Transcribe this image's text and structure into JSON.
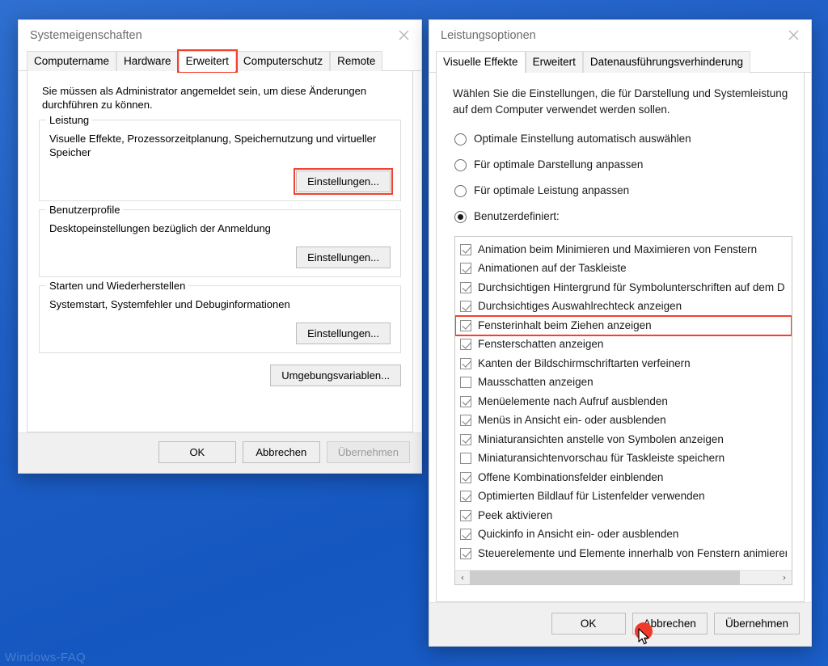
{
  "desktop": {
    "watermark": "Windows-FAQ",
    "background_color": "#1f5fc6"
  },
  "accent": {
    "highlight_color": "#f4402f",
    "click_dot_color": "#ef3a2a"
  },
  "system_properties": {
    "title": "Systemeigenschaften",
    "close_label": "close-icon",
    "tabs": [
      {
        "label": "Computername",
        "active": false
      },
      {
        "label": "Hardware",
        "active": false
      },
      {
        "label": "Erweitert",
        "active": true
      },
      {
        "label": "Computerschutz",
        "active": false
      },
      {
        "label": "Remote",
        "active": false
      }
    ],
    "admin_note": "Sie müssen als Administrator angemeldet sein, um diese Änderungen durchführen zu können.",
    "groups": [
      {
        "legend": "Leistung",
        "text": "Visuelle Effekte, Prozessorzeitplanung, Speichernutzung und virtueller Speicher",
        "button": "Einstellungen...",
        "highlighted": true
      },
      {
        "legend": "Benutzerprofile",
        "text": "Desktopeinstellungen bezüglich der Anmeldung",
        "button": "Einstellungen...",
        "highlighted": false
      },
      {
        "legend": "Starten und Wiederherstellen",
        "text": "Systemstart, Systemfehler und Debuginformationen",
        "button": "Einstellungen...",
        "highlighted": false
      }
    ],
    "env_button": "Umgebungsvariablen...",
    "footer": {
      "ok": "OK",
      "cancel": "Abbrechen",
      "apply": "Übernehmen",
      "apply_disabled": true
    }
  },
  "performance_options": {
    "title": "Leistungsoptionen",
    "close_label": "close-icon",
    "tabs": [
      {
        "label": "Visuelle Effekte",
        "active": true
      },
      {
        "label": "Erweitert",
        "active": false
      },
      {
        "label": "Datenausführungsverhinderung",
        "active": false
      }
    ],
    "intro": "Wählen Sie die Einstellungen, die für Darstellung und Systemleistung auf dem Computer verwendet werden sollen.",
    "radios": [
      {
        "label": "Optimale Einstellung automatisch auswählen",
        "checked": false
      },
      {
        "label": "Für optimale Darstellung anpassen",
        "checked": false
      },
      {
        "label": "Für optimale Leistung anpassen",
        "checked": false
      },
      {
        "label": "Benutzerdefiniert:",
        "checked": true
      }
    ],
    "effects": [
      {
        "label": "Animation beim Minimieren und Maximieren von Fenstern",
        "checked": true,
        "highlighted": false
      },
      {
        "label": "Animationen auf der Taskleiste",
        "checked": true,
        "highlighted": false
      },
      {
        "label": "Durchsichtigen Hintergrund für Symbolunterschriften auf dem D",
        "checked": true,
        "highlighted": false
      },
      {
        "label": "Durchsichtiges Auswahlrechteck anzeigen",
        "checked": true,
        "highlighted": false
      },
      {
        "label": "Fensterinhalt beim Ziehen anzeigen",
        "checked": true,
        "highlighted": true
      },
      {
        "label": "Fensterschatten anzeigen",
        "checked": true,
        "highlighted": false
      },
      {
        "label": "Kanten der Bildschirmschriftarten verfeinern",
        "checked": true,
        "highlighted": false
      },
      {
        "label": "Mausschatten anzeigen",
        "checked": false,
        "highlighted": false
      },
      {
        "label": "Menüelemente nach Aufruf ausblenden",
        "checked": true,
        "highlighted": false
      },
      {
        "label": "Menüs in Ansicht ein- oder ausblenden",
        "checked": true,
        "highlighted": false
      },
      {
        "label": "Miniaturansichten anstelle von Symbolen anzeigen",
        "checked": true,
        "highlighted": false
      },
      {
        "label": "Miniaturansichtenvorschau für Taskleiste speichern",
        "checked": false,
        "highlighted": false
      },
      {
        "label": "Offene Kombinationsfelder einblenden",
        "checked": true,
        "highlighted": false
      },
      {
        "label": "Optimierten Bildlauf für Listenfelder verwenden",
        "checked": true,
        "highlighted": false
      },
      {
        "label": "Peek aktivieren",
        "checked": true,
        "highlighted": false
      },
      {
        "label": "Quickinfo in Ansicht ein- oder ausblenden",
        "checked": true,
        "highlighted": false
      },
      {
        "label": "Steuerelemente und Elemente innerhalb von Fenstern animieren",
        "checked": true,
        "highlighted": false
      }
    ],
    "scroll": {
      "left_arrow": "‹",
      "right_arrow": "›"
    },
    "footer": {
      "ok": "OK",
      "cancel": "Abbrechen",
      "apply": "Übernehmen"
    }
  }
}
